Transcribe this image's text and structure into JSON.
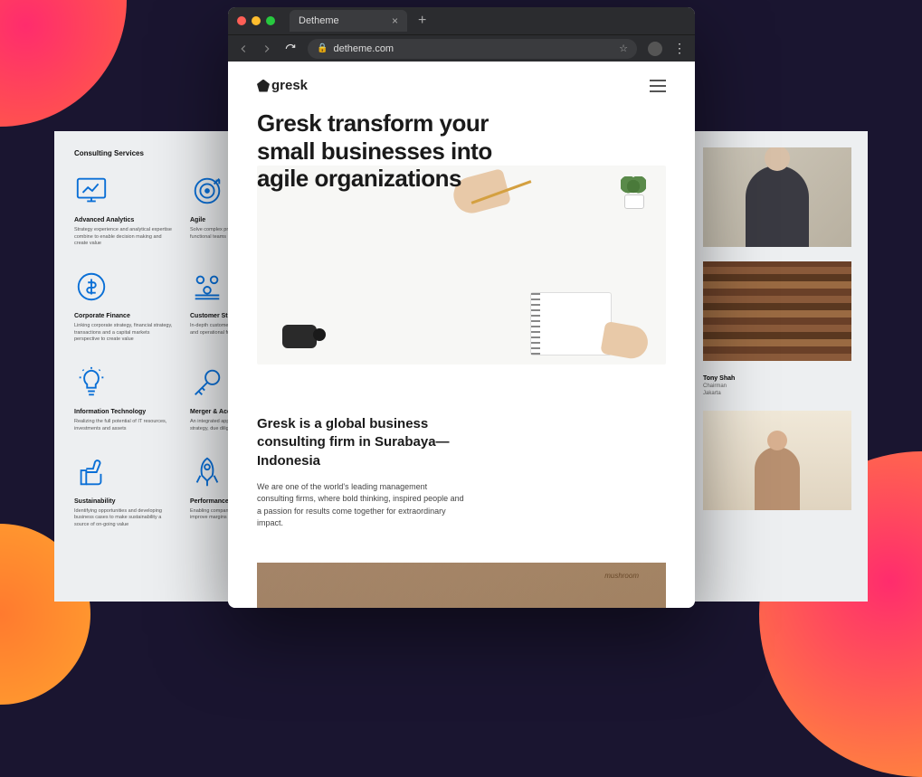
{
  "browser": {
    "tab_title": "Detheme",
    "url": "detheme.com"
  },
  "site": {
    "logo_text": "gresk",
    "hero_heading": "Gresk transform your small businesses into agile organizations",
    "intro_heading": "Gresk is a global business consulting firm in Surabaya—Indonesia",
    "intro_body": "We are one of the world's leading management consulting firms, where bold thinking, inspired people and a passion for results come together for extraordinary impact.",
    "cafe_sign": "mushroom"
  },
  "left_panel": {
    "title": "Consulting Services",
    "services": [
      {
        "name": "Advanced Analytics",
        "desc": "Strategy experience and analytical expertise combine to enable decision making and create value"
      },
      {
        "name": "Agile",
        "desc": "Solve complex problems with cross-functional teams using iterative approaches"
      },
      {
        "name": "",
        "desc": ""
      },
      {
        "name": "Corporate Finance",
        "desc": "Linking corporate strategy, financial strategy, transactions and a capital markets perspective to create value"
      },
      {
        "name": "Customer Strategy",
        "desc": "In-depth customer insights with economic and operational fundamentals"
      },
      {
        "name": "",
        "desc": ""
      },
      {
        "name": "Information Technology",
        "desc": "Realizing the full potential of IT resources, investments and assets"
      },
      {
        "name": "Merger & Acquisition",
        "desc": "An integrated approach linking acquisition strategy, due diligence and merger"
      },
      {
        "name": "",
        "desc": ""
      },
      {
        "name": "Sustainability",
        "desc": "Identifying opportunities and developing business cases to make sustainability a source of on-going value"
      },
      {
        "name": "Performance Improvement",
        "desc": "Enabling companies to grow revenue, improve margins and reposition quickly"
      },
      {
        "name": "",
        "desc": ""
      }
    ]
  },
  "right_panel": {
    "person_name": "Tony Shah",
    "person_role": "Chairman",
    "person_loc": "Jakarta"
  }
}
